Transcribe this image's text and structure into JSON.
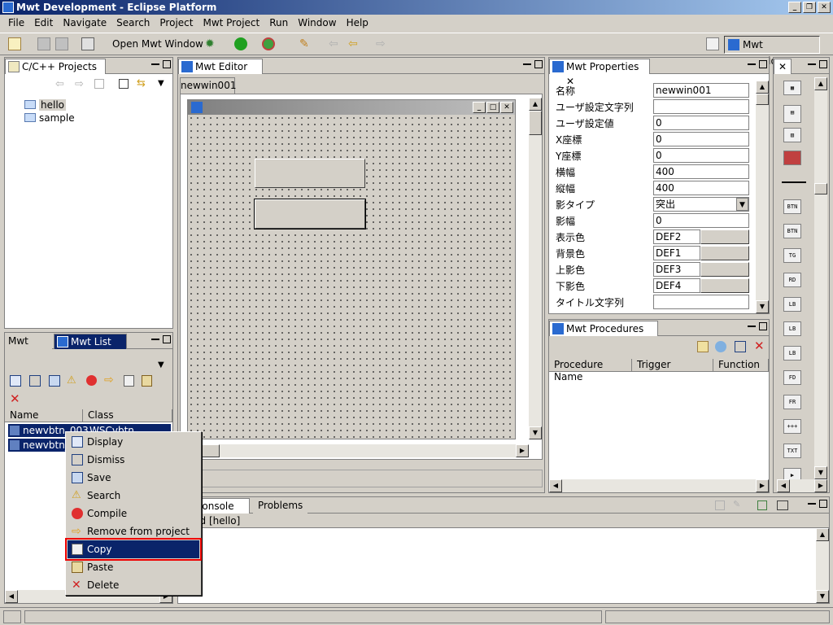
{
  "window": {
    "title": "Mwt Development - Eclipse Platform"
  },
  "menu": [
    "File",
    "Edit",
    "Navigate",
    "Search",
    "Project",
    "Mwt Project",
    "Run",
    "Window",
    "Help"
  ],
  "toolbar": {
    "open_mwt_window": "Open Mwt Window",
    "perspective": "Mwt Development"
  },
  "projects": {
    "tab": "C/C++ Projects",
    "items": [
      "hello",
      "sample"
    ]
  },
  "editor": {
    "tab": "Mwt Editor",
    "subtab": "newwin001"
  },
  "props": {
    "tab": "Mwt Properties",
    "rows": [
      {
        "k": "名称",
        "v": "newwin001"
      },
      {
        "k": "ユーザ設定文字列",
        "v": ""
      },
      {
        "k": "ユーザ設定値",
        "v": "0"
      },
      {
        "k": "X座標",
        "v": "0"
      },
      {
        "k": "Y座標",
        "v": "0"
      },
      {
        "k": "横幅",
        "v": "400"
      },
      {
        "k": "縦幅",
        "v": "400"
      },
      {
        "k": "影タイプ",
        "v": "突出"
      },
      {
        "k": "影幅",
        "v": "0"
      },
      {
        "k": "表示色",
        "v": "DEF2"
      },
      {
        "k": "背景色",
        "v": "DEF1"
      },
      {
        "k": "上影色",
        "v": "DEF3"
      },
      {
        "k": "下影色",
        "v": "DEF4"
      },
      {
        "k": "タイトル文字列",
        "v": ""
      }
    ]
  },
  "procedures": {
    "tab": "Mwt Procedures",
    "cols": [
      "Procedure Name",
      "Trigger",
      "Function Na"
    ]
  },
  "mwtlist": {
    "tabs": [
      "Mwt Tree",
      "Mwt List"
    ],
    "cols": [
      "Name",
      "Class"
    ],
    "rows": [
      {
        "name": "newvbtn_003",
        "cls": "WSCvbtn"
      },
      {
        "name": "newvbtn_00",
        "cls": ""
      }
    ]
  },
  "console": {
    "tabs": [
      "Console",
      "Problems"
    ],
    "line": "Build [hello]"
  },
  "contextmenu": [
    "Display",
    "Dismiss",
    "Save",
    "Search",
    "Compile",
    "Remove from project",
    "Copy",
    "Paste",
    "Delete"
  ],
  "palette": [
    "BTN",
    "BTN",
    "TG",
    "RD",
    "LB",
    "LB",
    "LB",
    "FD",
    "FR",
    "+++",
    "TXT",
    "▶"
  ]
}
